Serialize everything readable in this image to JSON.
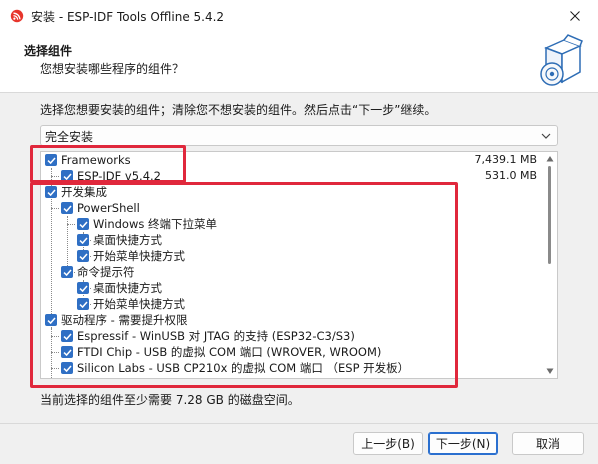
{
  "window": {
    "title": "安装 - ESP-IDF Tools Offline 5.4.2",
    "app_icon": "espressif-logo-icon",
    "close_icon": "close-icon"
  },
  "header": {
    "title": "选择组件",
    "subtitle": "您想安装哪些程序的组件？",
    "icon": "installer-box-disc-icon"
  },
  "main": {
    "instruction": "选择您想要安装的组件；清除您不想安装的组件。然后点击“下一步”继续。",
    "install_type": "完全安装",
    "components": [
      {
        "label": "Frameworks",
        "size": "7,439.1 MB",
        "checked": true
      },
      {
        "label": "ESP-IDF v5.4.2",
        "size": "531.0 MB",
        "checked": true
      },
      {
        "label": "开发集成",
        "size": "",
        "checked": true
      },
      {
        "label": "PowerShell",
        "size": "",
        "checked": true
      },
      {
        "label": "Windows 终端下拉菜单",
        "size": "",
        "checked": true
      },
      {
        "label": "桌面快捷方式",
        "size": "",
        "checked": true
      },
      {
        "label": "开始菜单快捷方式",
        "size": "",
        "checked": true
      },
      {
        "label": "命令提示符",
        "size": "",
        "checked": true
      },
      {
        "label": "桌面快捷方式",
        "size": "",
        "checked": true
      },
      {
        "label": "开始菜单快捷方式",
        "size": "",
        "checked": true
      },
      {
        "label": "驱动程序 - 需要提升权限",
        "size": "",
        "checked": true
      },
      {
        "label": "Espressif - WinUSB 对 JTAG 的支持 (ESP32-C3/S3)",
        "size": "",
        "checked": true
      },
      {
        "label": "FTDI Chip - USB 的虚拟 COM 端口 (WROVER, WROOM)",
        "size": "",
        "checked": true
      },
      {
        "label": "Silicon Labs - USB CP210x 的虚拟 COM 端口 （ESP 开发板）",
        "size": "",
        "checked": true
      }
    ],
    "space_required": "当前选择的组件至少需要 7.28 GB 的磁盘空间。"
  },
  "footer": {
    "back_label": "上一步(B)",
    "next_label": "下一步(N)",
    "cancel_label": "取消"
  },
  "colors": {
    "accent": "#2f6fc4",
    "highlight": "#e0283c"
  }
}
